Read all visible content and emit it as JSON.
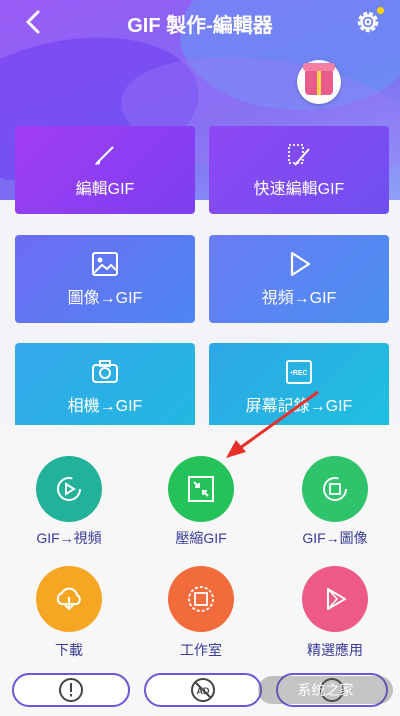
{
  "header": {
    "title": "GIF 製作-編輯器",
    "back_icon": "back-chevron-icon",
    "settings_icon": "gear-icon"
  },
  "promo": {
    "icon": "gift-box-icon"
  },
  "tiles": [
    {
      "label": "編輯GIF",
      "icon": "brush-icon"
    },
    {
      "label": "快速編輯GIF",
      "icon": "quick-brush-icon"
    },
    {
      "label": "圖像→GIF",
      "icon": "image-icon"
    },
    {
      "label": "視頻→GIF",
      "icon": "play-icon"
    },
    {
      "label": "相機→GIF",
      "icon": "camera-icon"
    },
    {
      "label": "屏幕記錄→GIF",
      "icon": "rec-icon",
      "badge": "•REC"
    }
  ],
  "tools": [
    {
      "label": "GIF→視頻",
      "icon": "gif-to-video-icon",
      "color": "#22b29a"
    },
    {
      "label": "壓縮GIF",
      "icon": "compress-icon",
      "color": "#25c25a"
    },
    {
      "label": "GIF→圖像",
      "icon": "gif-to-image-icon",
      "color": "#2fc46c"
    },
    {
      "label": "下載",
      "icon": "cloud-download-icon",
      "color": "#f5a623"
    },
    {
      "label": "工作室",
      "icon": "studio-icon",
      "color": "#f26b3a"
    },
    {
      "label": "精選應用",
      "icon": "featured-play-icon",
      "color": "#ee5a86"
    }
  ],
  "bottom": {
    "buttons": [
      {
        "icon": "alert-icon"
      },
      {
        "icon": "no-ads-icon",
        "text": "AD"
      },
      {
        "icon": "partial-icon"
      }
    ],
    "watermark": "系统之家"
  },
  "colors": {
    "accent": "#6b57d8",
    "arrow": "#e8302a"
  }
}
